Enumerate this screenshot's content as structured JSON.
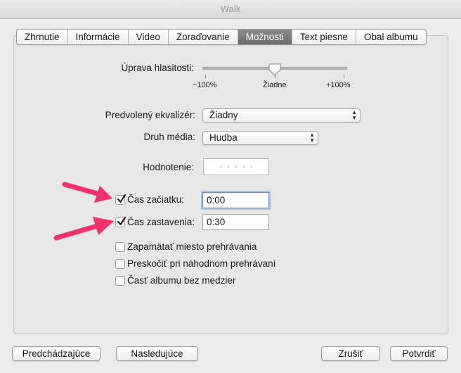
{
  "window": {
    "title": "Walk"
  },
  "tabs": [
    {
      "label": "Zhrnutie"
    },
    {
      "label": "Informácie"
    },
    {
      "label": "Video"
    },
    {
      "label": "Zoraďovanie"
    },
    {
      "label": "Možnosti",
      "active": true
    },
    {
      "label": "Text piesne"
    },
    {
      "label": "Obal albumu"
    }
  ],
  "volume": {
    "label": "Úprava hlasitosti:",
    "min_label": "−100%",
    "mid_label": "Žiadne",
    "max_label": "+100%",
    "value_percent": 0
  },
  "equalizer": {
    "label": "Predvolený ekvalizér:",
    "value": "Žiadny"
  },
  "media_kind": {
    "label": "Druh média:",
    "value": "Hudba"
  },
  "rating": {
    "label": "Hodnotenie:",
    "stars": 0
  },
  "start_time": {
    "label": "Čas začiatku:",
    "checked": true,
    "value": "0:00"
  },
  "stop_time": {
    "label": "Čas zastavenia:",
    "checked": true,
    "value": "0:30"
  },
  "options": [
    {
      "label": "Zapamätať miesto prehrávania",
      "checked": false
    },
    {
      "label": "Preskočiť pri náhodnom prehrávaní",
      "checked": false
    },
    {
      "label": "Časť albumu bez medzier",
      "checked": false
    }
  ],
  "buttons": {
    "previous": "Predchádzajúce",
    "next": "Nasledujúce",
    "cancel": "Zrušiť",
    "ok": "Potvrdiť"
  },
  "colors": {
    "annotation_arrow": "#f0326e",
    "active_tab": "#7a7a7a",
    "focus_ring": "#78a0dc"
  }
}
